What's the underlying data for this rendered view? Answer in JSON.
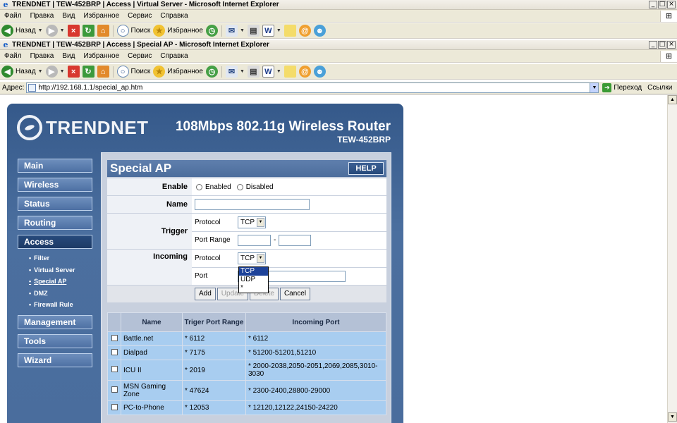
{
  "window1": {
    "title": "TRENDNET | TEW-452BRP | Access | Virtual Server - Microsoft Internet Explorer"
  },
  "window2": {
    "title": "TRENDNET | TEW-452BRP | Access | Special AP - Microsoft Internet Explorer"
  },
  "menu": [
    "Файл",
    "Правка",
    "Вид",
    "Избранное",
    "Сервис",
    "Справка"
  ],
  "toolbar": {
    "back": "Назад",
    "search": "Поиск",
    "favorites": "Избранное"
  },
  "address": {
    "label": "Адрес:",
    "url": "http://192.168.1.1/special_ap.htm",
    "go": "Переход",
    "links": "Ссылки"
  },
  "router": {
    "brand": "TRENDNET",
    "model_title": "108Mbps 802.11g Wireless Router",
    "model_sub": "TEW-452BRP"
  },
  "nav": {
    "main": "Main",
    "wireless": "Wireless",
    "status": "Status",
    "routing": "Routing",
    "access": "Access",
    "sub": [
      "Filter",
      "Virtual Server",
      "Special AP",
      "DMZ",
      "Firewall Rule"
    ],
    "management": "Management",
    "tools": "Tools",
    "wizard": "Wizard"
  },
  "page": {
    "title": "Special AP",
    "help": "HELP"
  },
  "form": {
    "enable_label": "Enable",
    "enabled": "Enabled",
    "disabled": "Disabled",
    "name_label": "Name",
    "trigger_label": "Trigger",
    "protocol_label": "Protocol",
    "trigger_protocol": "TCP",
    "port_range_label": "Port Range",
    "dash": "-",
    "incoming_label": "Incoming",
    "incoming_protocol": "TCP",
    "port_label": "Port",
    "dropdown_options": [
      "TCP",
      "UDP",
      "*"
    ],
    "add": "Add",
    "update": "Update",
    "delete": "Delete",
    "cancel": "Cancel"
  },
  "table": {
    "headers": [
      "Name",
      "Triger Port Range",
      "Incoming Port"
    ],
    "rows": [
      {
        "name": "Battle.net",
        "trigger": "* 6112",
        "incoming": "* 6112"
      },
      {
        "name": "Dialpad",
        "trigger": "* 7175",
        "incoming": "* 51200-51201,51210"
      },
      {
        "name": "ICU II",
        "trigger": "* 2019",
        "incoming": "* 2000-2038,2050-2051,2069,2085,3010-3030"
      },
      {
        "name": "MSN Gaming Zone",
        "trigger": "* 47624",
        "incoming": "* 2300-2400,28800-29000"
      },
      {
        "name": "PC-to-Phone",
        "trigger": "* 12053",
        "incoming": "* 12120,12122,24150-24220"
      }
    ]
  }
}
